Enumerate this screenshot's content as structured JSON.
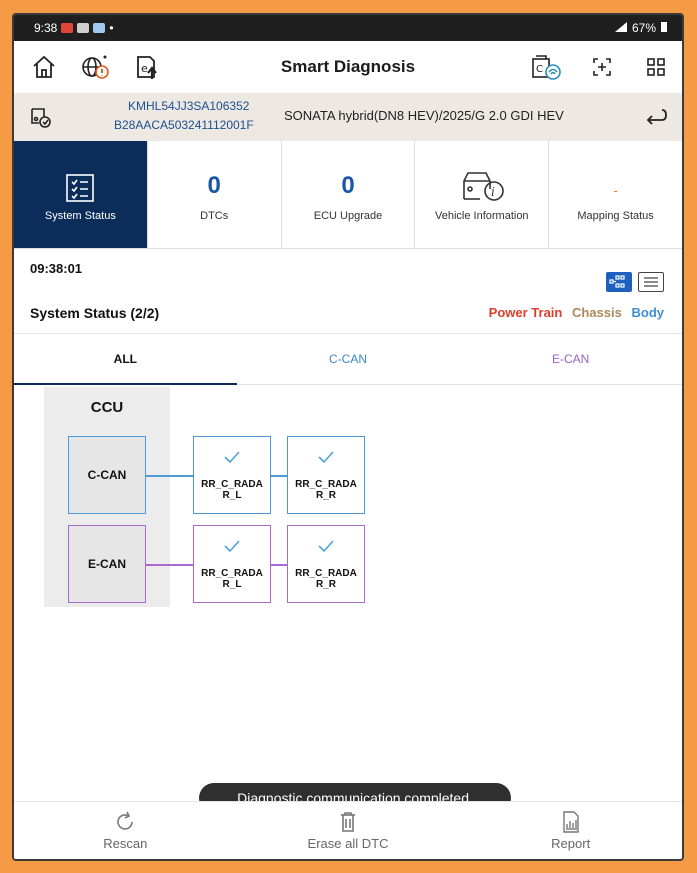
{
  "status_bar": {
    "time": "9:38",
    "dot": "•",
    "battery": "67%"
  },
  "app_bar": {
    "title": "Smart Diagnosis"
  },
  "vehicle": {
    "vin": "KMHL54JJ3SA106352",
    "serial": "B28AACA503241112001F",
    "model": "SONATA hybrid(DN8 HEV)/2025/G 2.0 GDI HEV"
  },
  "tiles": [
    {
      "label": "System Status"
    },
    {
      "value": "0",
      "label": "DTCs"
    },
    {
      "value": "0",
      "label": "ECU Upgrade"
    },
    {
      "label": "Vehicle Information"
    },
    {
      "value": "-",
      "label": "Mapping Status"
    }
  ],
  "section": {
    "time": "09:38:01",
    "title": "System Status (2/2)",
    "legend": {
      "power_train": "Power Train",
      "chassis": "Chassis",
      "body": "Body"
    },
    "legend_colors": {
      "power_train": "#d8402c",
      "chassis": "#a98a5a",
      "body": "#3d8fd1"
    }
  },
  "tabs": {
    "all": "ALL",
    "ccan": "C-CAN",
    "ecan": "E-CAN"
  },
  "diagram": {
    "module": "CCU",
    "buses": [
      {
        "name": "C-CAN",
        "nodes": [
          "RR_C_RADAR_L",
          "RR_C_RADAR_R"
        ]
      },
      {
        "name": "E-CAN",
        "nodes": [
          "RR_C_RADAR_L",
          "RR_C_RADAR_R"
        ]
      }
    ],
    "node_labels": {
      "c1a": "RR_C_RADA",
      "c1b": "R_L",
      "c2a": "RR_C_RADA",
      "c2b": "R_R",
      "e1a": "RR_C_RADA",
      "e1b": "R_L",
      "e2a": "RR_C_RADA",
      "e2b": "R_R"
    },
    "colors": {
      "c_can": "#4f9ad6",
      "e_can": "#a96ad0"
    }
  },
  "toast": "Diagnostic communication completed.",
  "bottom_bar": {
    "rescan": "Rescan",
    "erase": "Erase all DTC",
    "report": "Report"
  },
  "icons": [
    "home-icon",
    "globe-alert-icon",
    "upload-icon",
    "vci-connect-icon",
    "fullscreen-icon",
    "grid-icon",
    "vehicle-status-icon",
    "return-icon",
    "checklist-icon",
    "vehicle-info-icon",
    "topology-view-icon",
    "list-view-icon",
    "rescan-icon",
    "trash-icon",
    "report-icon"
  ]
}
